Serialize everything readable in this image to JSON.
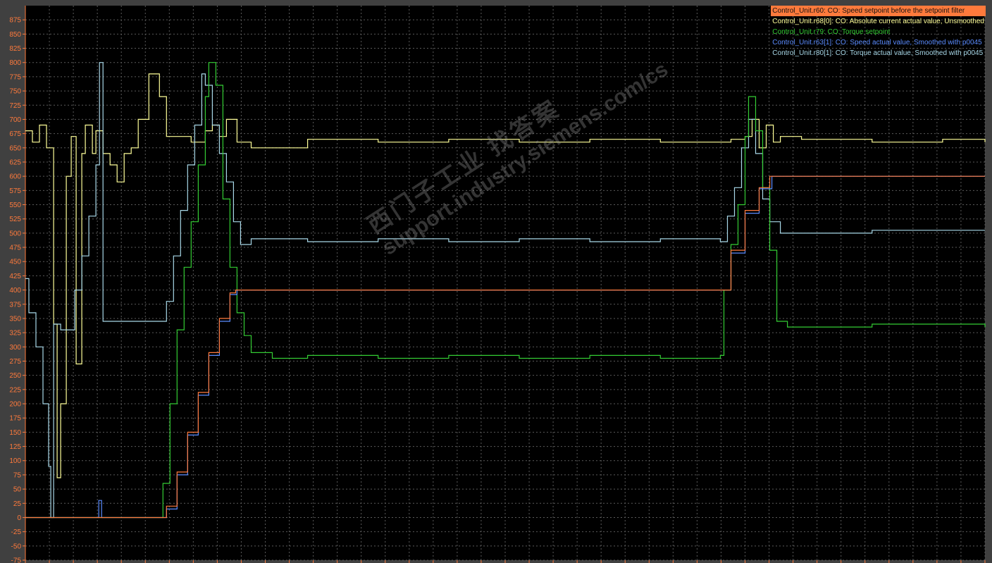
{
  "watermark": {
    "chinese": "西门子工业 找答案",
    "url": "support.industry.siemens.com/cs"
  },
  "legend": [
    {
      "label": "Control_Unit.r60: CO: Speed setpoint before the setpoint filter",
      "color": "#ff7a3c"
    },
    {
      "label": "Control_Unit.r68[0]: CO: Absolute current actual value, Unsmoothed",
      "color": "#ffff99"
    },
    {
      "label": "Control_Unit.r79: CO: Torque setpoint",
      "color": "#33cc33"
    },
    {
      "label": "Control_Unit.r63[1]: CO: Speed actual value, Smoothed with p0045",
      "color": "#5b8cff"
    },
    {
      "label": "Control_Unit.r80[1]: CO: Torque actual value, Smoothed with p0045",
      "color": "#a8d8e8"
    }
  ],
  "colors": {
    "background": "#000000",
    "grid": "#5a5a5a",
    "axis_text": "#ff7a3c",
    "frame": "#404040"
  },
  "chart_data": {
    "type": "line",
    "ylim": [
      -75,
      900
    ],
    "xlim": [
      0,
      1360
    ],
    "yticks": [
      "-75",
      "-50",
      "-25",
      "0",
      "25",
      "50",
      "75",
      "100",
      "125",
      "150",
      "175",
      "200",
      "225",
      "250",
      "275",
      "300",
      "325",
      "350",
      "375",
      "400",
      "425",
      "450",
      "475",
      "500",
      "525",
      "550",
      "575",
      "600",
      "625",
      "650",
      "675",
      "700",
      "725",
      "750",
      "775",
      "800",
      "825",
      "850",
      "875"
    ],
    "grid": true,
    "legend_position": "top-right",
    "series": [
      {
        "name": "Control_Unit.r60: CO: Speed setpoint before the setpoint filter",
        "points": [
          [
            0,
            0
          ],
          [
            188,
            0
          ],
          [
            200,
            20
          ],
          [
            215,
            80
          ],
          [
            230,
            150
          ],
          [
            245,
            220
          ],
          [
            260,
            290
          ],
          [
            275,
            350
          ],
          [
            290,
            395
          ],
          [
            298,
            400
          ],
          [
            985,
            400
          ],
          [
            1000,
            470
          ],
          [
            1020,
            540
          ],
          [
            1040,
            580
          ],
          [
            1055,
            600
          ],
          [
            1360,
            600
          ]
        ]
      },
      {
        "name": "Control_Unit.r68[0]: CO: Absolute current actual value, Unsmoothed",
        "points": [
          [
            0,
            680
          ],
          [
            10,
            660
          ],
          [
            20,
            690
          ],
          [
            30,
            650
          ],
          [
            40,
            340
          ],
          [
            45,
            70
          ],
          [
            50,
            200
          ],
          [
            58,
            600
          ],
          [
            65,
            670
          ],
          [
            72,
            270
          ],
          [
            80,
            640
          ],
          [
            85,
            690
          ],
          [
            95,
            640
          ],
          [
            100,
            680
          ],
          [
            110,
            640
          ],
          [
            120,
            620
          ],
          [
            130,
            590
          ],
          [
            140,
            640
          ],
          [
            150,
            650
          ],
          [
            160,
            700
          ],
          [
            175,
            780
          ],
          [
            190,
            740
          ],
          [
            200,
            670
          ],
          [
            215,
            670
          ],
          [
            235,
            660
          ],
          [
            245,
            660
          ],
          [
            255,
            680
          ],
          [
            265,
            690
          ],
          [
            275,
            670
          ],
          [
            285,
            700
          ],
          [
            300,
            660
          ],
          [
            320,
            650
          ],
          [
            400,
            665
          ],
          [
            500,
            660
          ],
          [
            600,
            665
          ],
          [
            700,
            660
          ],
          [
            800,
            665
          ],
          [
            900,
            660
          ],
          [
            1000,
            665
          ],
          [
            1020,
            670
          ],
          [
            1030,
            700
          ],
          [
            1040,
            650
          ],
          [
            1050,
            690
          ],
          [
            1060,
            660
          ],
          [
            1070,
            670
          ],
          [
            1100,
            665
          ],
          [
            1200,
            660
          ],
          [
            1300,
            665
          ],
          [
            1360,
            660
          ]
        ]
      },
      {
        "name": "Control_Unit.r79: CO: Torque setpoint",
        "points": [
          [
            0,
            0
          ],
          [
            190,
            0
          ],
          [
            195,
            60
          ],
          [
            205,
            200
          ],
          [
            215,
            330
          ],
          [
            225,
            440
          ],
          [
            235,
            520
          ],
          [
            245,
            620
          ],
          [
            255,
            740
          ],
          [
            260,
            800
          ],
          [
            270,
            760
          ],
          [
            280,
            560
          ],
          [
            290,
            440
          ],
          [
            300,
            360
          ],
          [
            310,
            320
          ],
          [
            320,
            290
          ],
          [
            350,
            280
          ],
          [
            400,
            285
          ],
          [
            500,
            280
          ],
          [
            600,
            285
          ],
          [
            700,
            280
          ],
          [
            800,
            285
          ],
          [
            900,
            280
          ],
          [
            985,
            285
          ],
          [
            990,
            400
          ],
          [
            1000,
            480
          ],
          [
            1010,
            550
          ],
          [
            1020,
            670
          ],
          [
            1025,
            740
          ],
          [
            1035,
            680
          ],
          [
            1045,
            580
          ],
          [
            1055,
            470
          ],
          [
            1065,
            345
          ],
          [
            1080,
            335
          ],
          [
            1200,
            340
          ],
          [
            1360,
            335
          ]
        ]
      },
      {
        "name": "Control_Unit.r63[1]: CO: Speed actual value, Smoothed with p0045",
        "points": [
          [
            0,
            0
          ],
          [
            102,
            0
          ],
          [
            104,
            30
          ],
          [
            108,
            0
          ],
          [
            188,
            0
          ],
          [
            200,
            15
          ],
          [
            215,
            75
          ],
          [
            230,
            145
          ],
          [
            245,
            215
          ],
          [
            260,
            285
          ],
          [
            275,
            345
          ],
          [
            290,
            392
          ],
          [
            300,
            400
          ],
          [
            985,
            400
          ],
          [
            1000,
            465
          ],
          [
            1020,
            535
          ],
          [
            1040,
            578
          ],
          [
            1058,
            600
          ],
          [
            1360,
            600
          ]
        ]
      },
      {
        "name": "Control_Unit.r80[1]: CO: Torque actual value, Smoothed with p0045",
        "points": [
          [
            0,
            420
          ],
          [
            5,
            360
          ],
          [
            15,
            300
          ],
          [
            25,
            200
          ],
          [
            33,
            90
          ],
          [
            36,
            0
          ],
          [
            40,
            340
          ],
          [
            50,
            330
          ],
          [
            60,
            330
          ],
          [
            70,
            400
          ],
          [
            80,
            460
          ],
          [
            90,
            530
          ],
          [
            100,
            620
          ],
          [
            105,
            800
          ],
          [
            110,
            345
          ],
          [
            150,
            345
          ],
          [
            190,
            345
          ],
          [
            200,
            380
          ],
          [
            210,
            460
          ],
          [
            220,
            540
          ],
          [
            230,
            620
          ],
          [
            240,
            690
          ],
          [
            250,
            780
          ],
          [
            255,
            760
          ],
          [
            265,
            690
          ],
          [
            275,
            640
          ],
          [
            285,
            590
          ],
          [
            295,
            520
          ],
          [
            305,
            480
          ],
          [
            320,
            490
          ],
          [
            400,
            485
          ],
          [
            500,
            490
          ],
          [
            600,
            485
          ],
          [
            700,
            490
          ],
          [
            800,
            485
          ],
          [
            900,
            490
          ],
          [
            985,
            485
          ],
          [
            995,
            530
          ],
          [
            1005,
            580
          ],
          [
            1015,
            650
          ],
          [
            1025,
            700
          ],
          [
            1035,
            640
          ],
          [
            1045,
            560
          ],
          [
            1055,
            520
          ],
          [
            1070,
            500
          ],
          [
            1200,
            505
          ],
          [
            1360,
            505
          ]
        ]
      }
    ]
  }
}
